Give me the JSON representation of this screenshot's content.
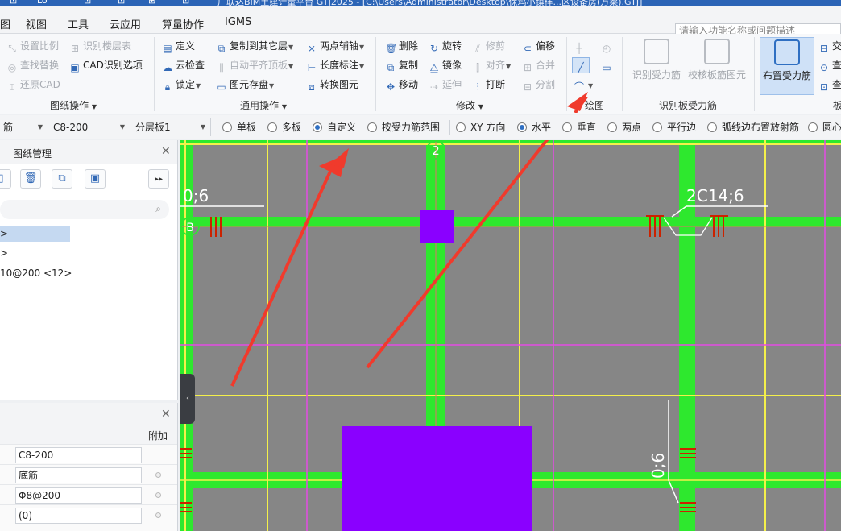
{
  "app": {
    "title": "广联达BIM土建计量平台 GTJ2025 - [C:\\Users\\Administrator\\Desktop\\保鸡小镇样...区设备房(万柔).GTJ]",
    "quick_access": [
      "⊡",
      "Lo",
      "⊡",
      "⊡",
      "⊞",
      "⊡"
    ]
  },
  "menu": {
    "items": [
      "图",
      "视图",
      "工具",
      "云应用",
      "算量协作",
      "IGMS"
    ],
    "search_placeholder": "请输入功能名称或问题描述"
  },
  "ribbon": {
    "cad_ops": {
      "label": "图纸操作",
      "set_scale": "设置比例",
      "find_replace": "查找替换",
      "restore_cad": "还原CAD",
      "identify_floor_table": "识别楼层表",
      "cad_identify_options": "CAD识别选项"
    },
    "common_ops": {
      "label": "通用操作",
      "define": "定义",
      "cloud_check": "云检查",
      "lock": "锁定",
      "copy_to_other_floor": "复制到其它层",
      "auto_level_top": "自动平齐顶板",
      "element_save": "图元存盘",
      "two_point_axis": "两点辅轴",
      "length_dim": "长度标注",
      "convert_element": "转换图元"
    },
    "modify": {
      "label": "修改",
      "delete": "删除",
      "copy": "复制",
      "move": "移动",
      "rotate": "旋转",
      "mirror": "镜像",
      "extend": "延伸",
      "trim": "修剪",
      "align": "对齐",
      "break": "打断",
      "offset": "偏移",
      "merge": "合并",
      "split": "分割"
    },
    "draw": {
      "label": "绘图"
    },
    "identify_slab_rebar": {
      "label": "识别板受力筋",
      "identify_rebar": "识别受力筋",
      "check_slab_rebar": "校核板筋图元"
    },
    "place_rebar": {
      "label": "布置受力筋"
    },
    "right_partial": {
      "label": "板",
      "items": [
        "交",
        "查",
        "查"
      ]
    }
  },
  "option_bar": {
    "type_combo": "筋",
    "spec_combo": "C8-200",
    "layer_combo": "分层板1",
    "mode_radios": [
      {
        "label": "单板",
        "checked": false
      },
      {
        "label": "多板",
        "checked": false
      },
      {
        "label": "自定义",
        "checked": true
      },
      {
        "label": "按受力筋范围",
        "checked": false
      }
    ],
    "dir_radios": [
      {
        "label": "XY 方向",
        "checked": false
      },
      {
        "label": "水平",
        "checked": true
      },
      {
        "label": "垂直",
        "checked": false
      },
      {
        "label": "两点",
        "checked": false
      },
      {
        "label": "平行边",
        "checked": false
      },
      {
        "label": "弧线边布置放射筋",
        "checked": false
      },
      {
        "label": "圆心",
        "checked": false
      }
    ]
  },
  "drawing_panel": {
    "title": "图纸管理",
    "tree": [
      ">",
      ">",
      "10@200 <12>"
    ]
  },
  "property_panel": {
    "extra_header": "附加",
    "rows": [
      "C8-200",
      "底筋",
      "Φ8@200",
      "(0)"
    ]
  },
  "canvas": {
    "axis_labels": [
      "2",
      "B"
    ],
    "annotations": [
      "0;6",
      "2C14;6",
      "0;6"
    ],
    "colors": {
      "background": "#868686",
      "beam": "#2ee82e",
      "grid_yellow": "#f4f04a",
      "grid_magenta": "#e34be3",
      "column": "#8a00ff",
      "rebar_mark": "#cc2200",
      "arrow": "#f03a2c"
    }
  }
}
